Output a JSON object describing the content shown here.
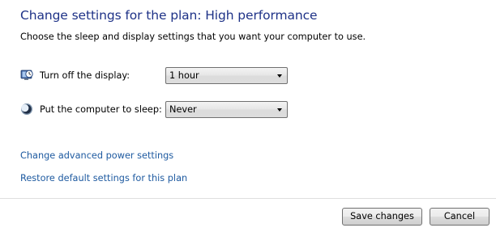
{
  "header": {
    "title": "Change settings for the plan: High performance",
    "subtitle": "Choose the sleep and display settings that you want your computer to use."
  },
  "settings": [
    {
      "icon": "monitor-clock-icon",
      "label": "Turn off the display:",
      "selected": "1 hour"
    },
    {
      "icon": "moon-sleep-icon",
      "label": "Put the computer to sleep:",
      "selected": "Never"
    }
  ],
  "links": {
    "advanced": "Change advanced power settings",
    "restore": "Restore default settings for this plan"
  },
  "buttons": {
    "save": "Save changes",
    "cancel": "Cancel"
  },
  "colors": {
    "title": "#1e3287",
    "link": "#1e5aa0"
  }
}
